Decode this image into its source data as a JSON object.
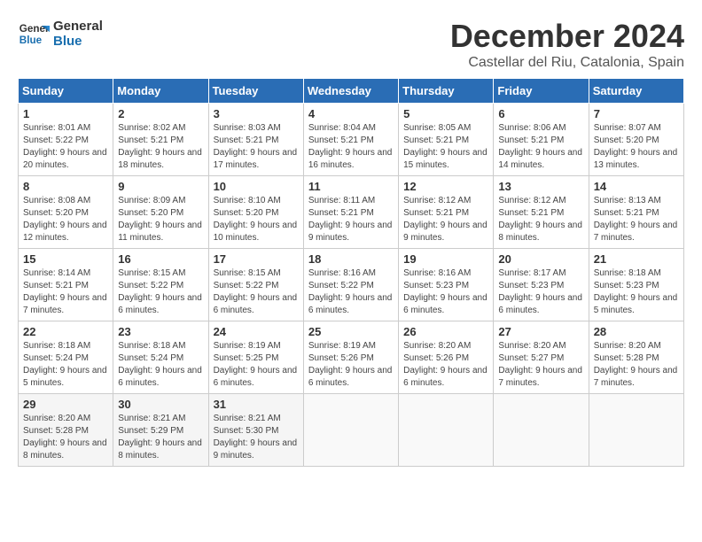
{
  "logo": {
    "line1": "General",
    "line2": "Blue"
  },
  "title": "December 2024",
  "subtitle": "Castellar del Riu, Catalonia, Spain",
  "headers": [
    "Sunday",
    "Monday",
    "Tuesday",
    "Wednesday",
    "Thursday",
    "Friday",
    "Saturday"
  ],
  "weeks": [
    [
      {
        "day": "1",
        "info": "Sunrise: 8:01 AM\nSunset: 5:22 PM\nDaylight: 9 hours and 20 minutes."
      },
      {
        "day": "2",
        "info": "Sunrise: 8:02 AM\nSunset: 5:21 PM\nDaylight: 9 hours and 18 minutes."
      },
      {
        "day": "3",
        "info": "Sunrise: 8:03 AM\nSunset: 5:21 PM\nDaylight: 9 hours and 17 minutes."
      },
      {
        "day": "4",
        "info": "Sunrise: 8:04 AM\nSunset: 5:21 PM\nDaylight: 9 hours and 16 minutes."
      },
      {
        "day": "5",
        "info": "Sunrise: 8:05 AM\nSunset: 5:21 PM\nDaylight: 9 hours and 15 minutes."
      },
      {
        "day": "6",
        "info": "Sunrise: 8:06 AM\nSunset: 5:21 PM\nDaylight: 9 hours and 14 minutes."
      },
      {
        "day": "7",
        "info": "Sunrise: 8:07 AM\nSunset: 5:20 PM\nDaylight: 9 hours and 13 minutes."
      }
    ],
    [
      {
        "day": "8",
        "info": "Sunrise: 8:08 AM\nSunset: 5:20 PM\nDaylight: 9 hours and 12 minutes."
      },
      {
        "day": "9",
        "info": "Sunrise: 8:09 AM\nSunset: 5:20 PM\nDaylight: 9 hours and 11 minutes."
      },
      {
        "day": "10",
        "info": "Sunrise: 8:10 AM\nSunset: 5:20 PM\nDaylight: 9 hours and 10 minutes."
      },
      {
        "day": "11",
        "info": "Sunrise: 8:11 AM\nSunset: 5:21 PM\nDaylight: 9 hours and 9 minutes."
      },
      {
        "day": "12",
        "info": "Sunrise: 8:12 AM\nSunset: 5:21 PM\nDaylight: 9 hours and 9 minutes."
      },
      {
        "day": "13",
        "info": "Sunrise: 8:12 AM\nSunset: 5:21 PM\nDaylight: 9 hours and 8 minutes."
      },
      {
        "day": "14",
        "info": "Sunrise: 8:13 AM\nSunset: 5:21 PM\nDaylight: 9 hours and 7 minutes."
      }
    ],
    [
      {
        "day": "15",
        "info": "Sunrise: 8:14 AM\nSunset: 5:21 PM\nDaylight: 9 hours and 7 minutes."
      },
      {
        "day": "16",
        "info": "Sunrise: 8:15 AM\nSunset: 5:22 PM\nDaylight: 9 hours and 6 minutes."
      },
      {
        "day": "17",
        "info": "Sunrise: 8:15 AM\nSunset: 5:22 PM\nDaylight: 9 hours and 6 minutes."
      },
      {
        "day": "18",
        "info": "Sunrise: 8:16 AM\nSunset: 5:22 PM\nDaylight: 9 hours and 6 minutes."
      },
      {
        "day": "19",
        "info": "Sunrise: 8:16 AM\nSunset: 5:23 PM\nDaylight: 9 hours and 6 minutes."
      },
      {
        "day": "20",
        "info": "Sunrise: 8:17 AM\nSunset: 5:23 PM\nDaylight: 9 hours and 6 minutes."
      },
      {
        "day": "21",
        "info": "Sunrise: 8:18 AM\nSunset: 5:23 PM\nDaylight: 9 hours and 5 minutes."
      }
    ],
    [
      {
        "day": "22",
        "info": "Sunrise: 8:18 AM\nSunset: 5:24 PM\nDaylight: 9 hours and 5 minutes."
      },
      {
        "day": "23",
        "info": "Sunrise: 8:18 AM\nSunset: 5:24 PM\nDaylight: 9 hours and 6 minutes."
      },
      {
        "day": "24",
        "info": "Sunrise: 8:19 AM\nSunset: 5:25 PM\nDaylight: 9 hours and 6 minutes."
      },
      {
        "day": "25",
        "info": "Sunrise: 8:19 AM\nSunset: 5:26 PM\nDaylight: 9 hours and 6 minutes."
      },
      {
        "day": "26",
        "info": "Sunrise: 8:20 AM\nSunset: 5:26 PM\nDaylight: 9 hours and 6 minutes."
      },
      {
        "day": "27",
        "info": "Sunrise: 8:20 AM\nSunset: 5:27 PM\nDaylight: 9 hours and 7 minutes."
      },
      {
        "day": "28",
        "info": "Sunrise: 8:20 AM\nSunset: 5:28 PM\nDaylight: 9 hours and 7 minutes."
      }
    ],
    [
      {
        "day": "29",
        "info": "Sunrise: 8:20 AM\nSunset: 5:28 PM\nDaylight: 9 hours and 8 minutes."
      },
      {
        "day": "30",
        "info": "Sunrise: 8:21 AM\nSunset: 5:29 PM\nDaylight: 9 hours and 8 minutes."
      },
      {
        "day": "31",
        "info": "Sunrise: 8:21 AM\nSunset: 5:30 PM\nDaylight: 9 hours and 9 minutes."
      },
      null,
      null,
      null,
      null
    ]
  ]
}
